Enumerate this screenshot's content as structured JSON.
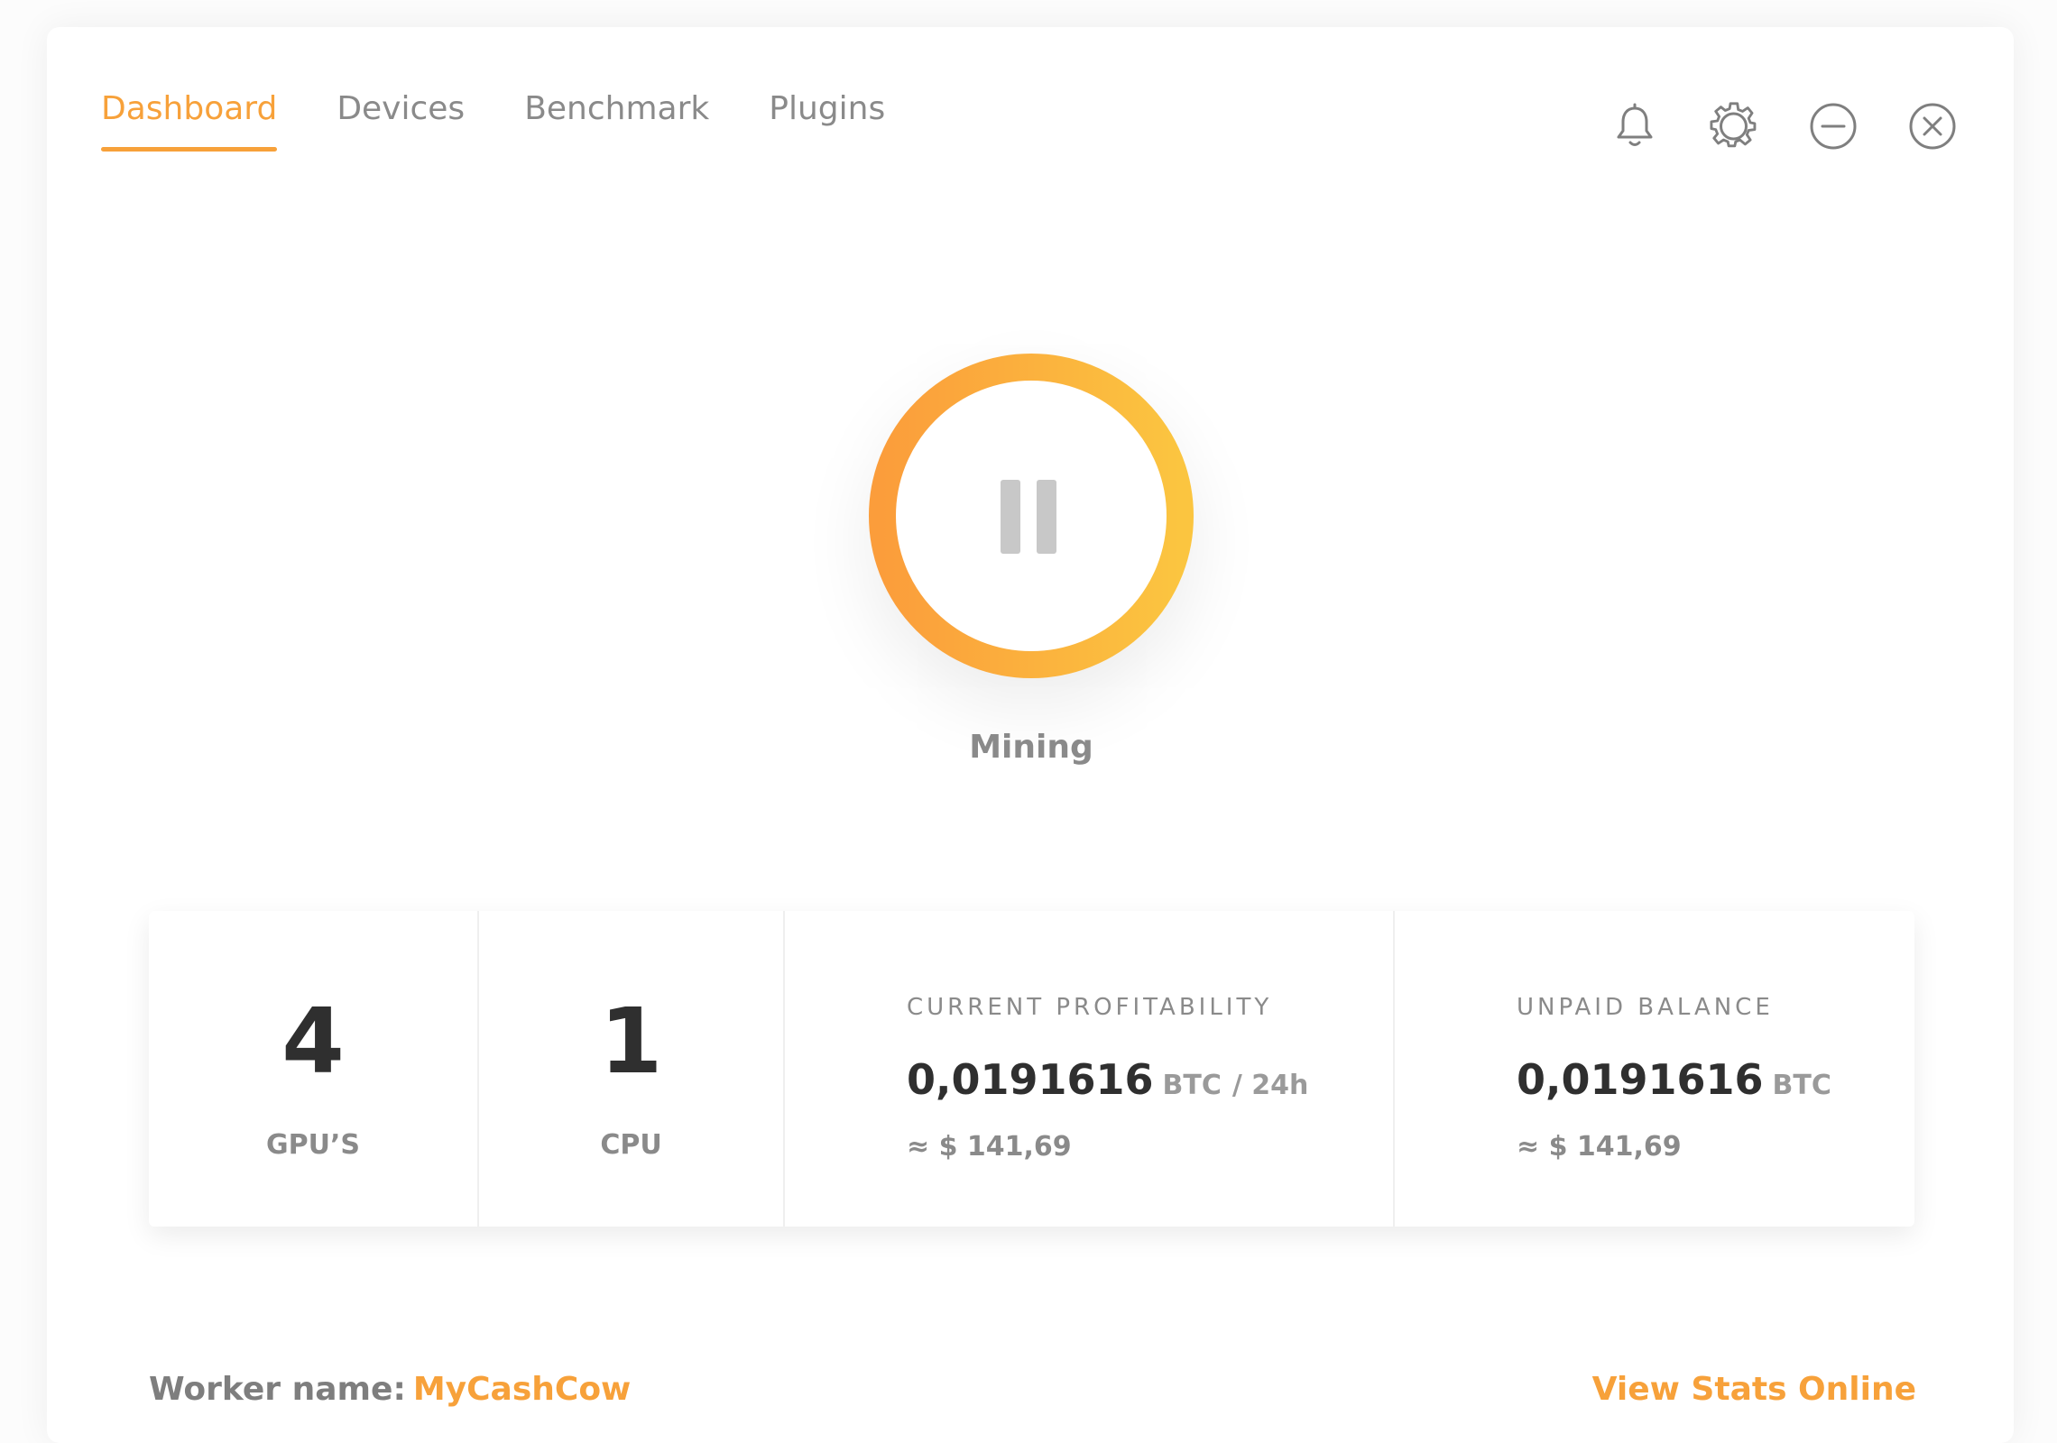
{
  "nav": {
    "tabs": [
      {
        "label": "Dashboard",
        "active": true
      },
      {
        "label": "Devices",
        "active": false
      },
      {
        "label": "Benchmark",
        "active": false
      },
      {
        "label": "Plugins",
        "active": false
      }
    ],
    "window_icons": [
      "bell-icon",
      "gear-icon",
      "minimize-icon",
      "close-icon"
    ]
  },
  "mining": {
    "state_label": "Mining",
    "icon": "pause-icon",
    "ring_colors": [
      "#fb9d3b",
      "#fbc540"
    ]
  },
  "stats": {
    "gpus": {
      "value": "4",
      "label": "GPU’S"
    },
    "cpu": {
      "value": "1",
      "label": "CPU"
    },
    "profitability": {
      "title": "CURRENT PROFITABILITY",
      "amount": "0,0191616",
      "unit": "BTC",
      "period": "/ 24h",
      "fiat": "≈ $ 141,69"
    },
    "balance": {
      "title": "UNPAID BALANCE",
      "amount": "0,0191616",
      "unit": "BTC",
      "fiat": "≈ $ 141,69"
    }
  },
  "footer": {
    "worker_label": "Worker name:",
    "worker_name": "MyCashCow",
    "view_stats": "View Stats Online"
  },
  "colors": {
    "accent": "#f7a13a",
    "text_dark": "#2f2f2f",
    "text_muted": "#8a8a8a"
  }
}
